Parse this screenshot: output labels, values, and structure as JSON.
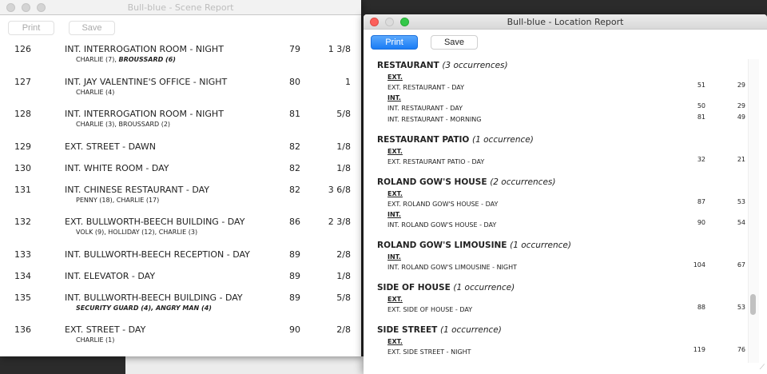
{
  "scene_window": {
    "title": "Bull-blue - Scene Report",
    "print": "Print",
    "save": "Save",
    "rows": [
      {
        "num": "126",
        "title": "INT. INTERROGATION ROOM - NIGHT",
        "page": "79",
        "length": "1 3/8",
        "cast": "CHARLIE (7), ",
        "cast_bold": "BROUSSARD (6)"
      },
      {
        "num": "127",
        "title": "INT. JAY VALENTINE'S OFFICE - NIGHT",
        "page": "80",
        "length": "1",
        "cast": "CHARLIE (4)",
        "cast_bold": ""
      },
      {
        "num": "128",
        "title": "INT. INTERROGATION ROOM - NIGHT",
        "page": "81",
        "length": "5/8",
        "cast": "CHARLIE (3), BROUSSARD (2)",
        "cast_bold": ""
      },
      {
        "num": "129",
        "title": "EXT. STREET - DAWN",
        "page": "82",
        "length": "1/8",
        "cast": "",
        "cast_bold": ""
      },
      {
        "num": "130",
        "title": "INT. WHITE ROOM - DAY",
        "page": "82",
        "length": "1/8",
        "cast": "",
        "cast_bold": ""
      },
      {
        "num": "131",
        "title": "INT. CHINESE RESTAURANT - DAY",
        "page": "82",
        "length": "3 6/8",
        "cast": "PENNY (18), CHARLIE (17)",
        "cast_bold": ""
      },
      {
        "num": "132",
        "title": "EXT. BULLWORTH-BEECH BUILDING - DAY",
        "page": "86",
        "length": "2 3/8",
        "cast": "VOLK (9), HOLLIDAY (12), CHARLIE (3)",
        "cast_bold": ""
      },
      {
        "num": "133",
        "title": "INT. BULLWORTH-BEECH RECEPTION - DAY",
        "page": "89",
        "length": "2/8",
        "cast": "",
        "cast_bold": ""
      },
      {
        "num": "134",
        "title": "INT. ELEVATOR - DAY",
        "page": "89",
        "length": "1/8",
        "cast": "",
        "cast_bold": ""
      },
      {
        "num": "135",
        "title": "INT. BULLWORTH-BEECH BUILDING - DAY",
        "page": "89",
        "length": "5/8",
        "cast": "",
        "cast_bold": "SECURITY GUARD (4), ANGRY MAN (4)"
      },
      {
        "num": "136",
        "title": "EXT. STREET - DAY",
        "page": "90",
        "length": "2/8",
        "cast": "CHARLIE (1)",
        "cast_bold": ""
      }
    ]
  },
  "location_window": {
    "title": "Bull-blue - Location Report",
    "print": "Print",
    "save": "Save",
    "scroll_position": 0.8,
    "groups": [
      {
        "name": "RESTAURANT",
        "count": "(3 occurrences)",
        "sections": [
          {
            "label": "EXT.",
            "items": [
              [
                "EXT. RESTAURANT - DAY",
                "51",
                "29"
              ]
            ]
          },
          {
            "label": "INT.",
            "items": [
              [
                "INT. RESTAURANT - DAY",
                "50",
                "29"
              ],
              [
                "INT. RESTAURANT - MORNING",
                "81",
                "49"
              ]
            ]
          }
        ]
      },
      {
        "name": "RESTAURANT PATIO",
        "count": "(1 occurrence)",
        "sections": [
          {
            "label": "EXT.",
            "items": [
              [
                "EXT. RESTAURANT PATIO - DAY",
                "32",
                "21"
              ]
            ]
          }
        ]
      },
      {
        "name": "ROLAND GOW'S HOUSE",
        "count": "(2 occurrences)",
        "sections": [
          {
            "label": "EXT.",
            "items": [
              [
                "EXT. ROLAND GOW'S HOUSE - DAY",
                "87",
                "53"
              ]
            ]
          },
          {
            "label": "INT.",
            "items": [
              [
                "INT. ROLAND GOW'S HOUSE - DAY",
                "90",
                "54"
              ]
            ]
          }
        ]
      },
      {
        "name": "ROLAND GOW'S LIMOUSINE",
        "count": "(1 occurrence)",
        "sections": [
          {
            "label": "INT.",
            "items": [
              [
                "INT. ROLAND GOW'S LIMOUSINE - NIGHT",
                "104",
                "67"
              ]
            ]
          }
        ]
      },
      {
        "name": "SIDE OF HOUSE",
        "count": "(1 occurrence)",
        "sections": [
          {
            "label": "EXT.",
            "items": [
              [
                "EXT. SIDE OF HOUSE - DAY",
                "88",
                "53"
              ]
            ]
          }
        ]
      },
      {
        "name": "SIDE STREET",
        "count": "(1 occurrence)",
        "sections": [
          {
            "label": "EXT.",
            "items": [
              [
                "EXT. SIDE STREET - NIGHT",
                "119",
                "76"
              ]
            ]
          }
        ]
      }
    ]
  }
}
